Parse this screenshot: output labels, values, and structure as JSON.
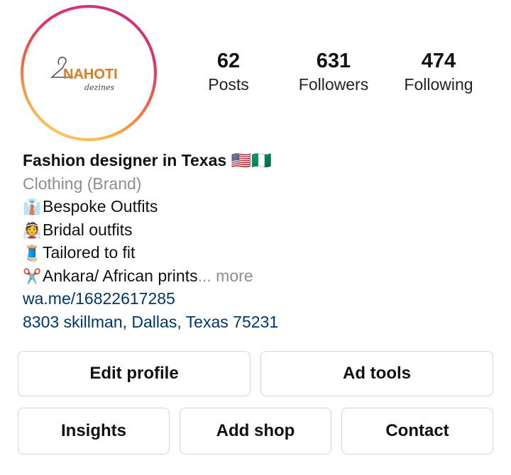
{
  "profile": {
    "avatar_logo_text": "NAHOTI",
    "avatar_logo_subtext": "dezines",
    "ring_gradient": [
      "#c13584",
      "#e1306c",
      "#f56040",
      "#fcaf45",
      "#ffdc80"
    ]
  },
  "stats": [
    {
      "value": "62",
      "label": "Posts"
    },
    {
      "value": "631",
      "label": "Followers"
    },
    {
      "value": "474",
      "label": "Following"
    }
  ],
  "bio": {
    "name": "Fashion designer in Texas",
    "name_flags": "🇺🇸🇳🇬",
    "category": "Clothing (Brand)",
    "lines": [
      {
        "emoji": "👔",
        "text": "Bespoke Outfits"
      },
      {
        "emoji": "👰",
        "text": "Bridal outfits"
      },
      {
        "emoji": "🧵",
        "text": "Tailored to fit"
      },
      {
        "emoji": "✂️",
        "text": "Ankara/ African prints"
      }
    ],
    "more_text": "... more",
    "link": "wa.me/16822617285",
    "address": "8303 skillman, Dallas, Texas 75231"
  },
  "buttons": {
    "edit_profile": "Edit profile",
    "ad_tools": "Ad tools",
    "insights": "Insights",
    "add_shop": "Add shop",
    "contact": "Contact"
  },
  "colors": {
    "link": "#00376b",
    "secondary_text": "#8e8e8e",
    "button_border": "#d5d5d5",
    "logo_orange": "#e07a1f"
  }
}
